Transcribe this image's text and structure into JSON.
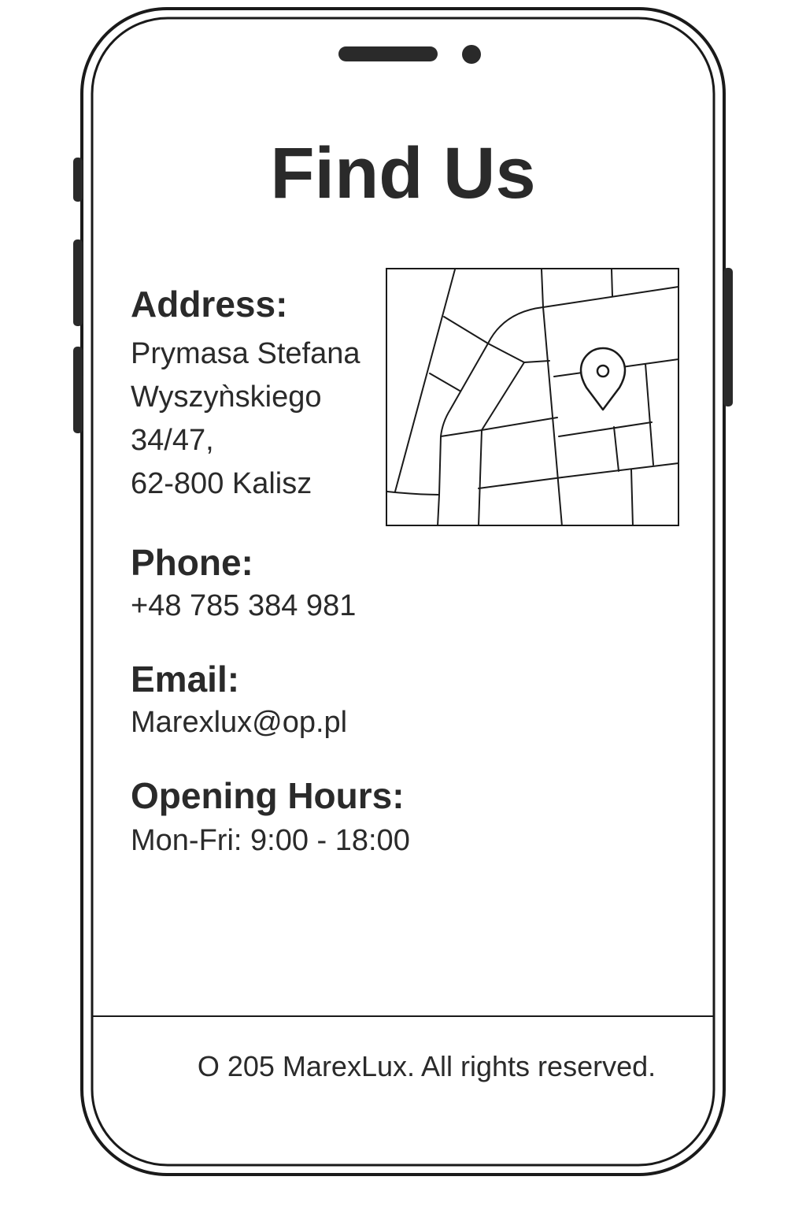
{
  "page": {
    "title": "Find Us"
  },
  "address": {
    "label": "Address:",
    "lines": [
      "Prymasa Stefana",
      "Wyszyǹskiego",
      "34/47,",
      "62-800 Kalisz"
    ]
  },
  "phone": {
    "label": "Phone:",
    "value": "+48 785 384 981"
  },
  "email": {
    "label": "Email:",
    "value": "Marexlux@op.pl"
  },
  "hours": {
    "label": "Opening Hours:",
    "value": "Mon-Fri: 9:00 - 18:00"
  },
  "footer": {
    "text": "O 205 MarexLux. All rights reserved."
  },
  "map": {
    "icon": "map-pin-icon"
  },
  "colors": {
    "ink": "#2a2a2a",
    "outline": "#1a1a1a",
    "background": "#ffffff"
  }
}
